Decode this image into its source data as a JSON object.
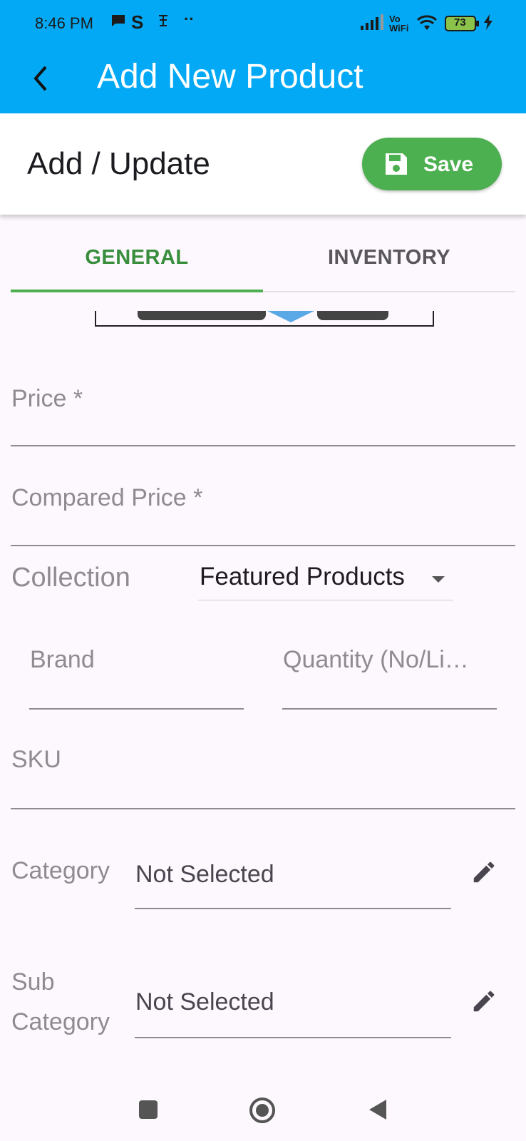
{
  "status_bar": {
    "time": "8:46 PM",
    "network": "Vo WiFi",
    "battery": "73"
  },
  "app_bar": {
    "title": "Add New Product",
    "back_icon": "chevron-left-icon"
  },
  "header": {
    "title": "Add / Update",
    "save_label": "Save",
    "save_icon": "floppy-disk-icon",
    "save_color": "#4caf50"
  },
  "tabs": [
    {
      "label": "GENERAL",
      "active": true
    },
    {
      "label": "INVENTORY",
      "active": false
    }
  ],
  "form": {
    "price_label": "Price *",
    "compared_price_label": "Compared Price *",
    "collection_label": "Collection",
    "collection_value": "Featured Products",
    "brand_label": "Brand",
    "quantity_label": "Quantity (No/Li…",
    "sku_label": "SKU",
    "category_label": "Category",
    "category_value": "Not Selected",
    "subcategory_label_line1": "Sub",
    "subcategory_label_line2": "Category",
    "subcategory_value": "Not Selected"
  },
  "colors": {
    "app_bar": "#03a9f4",
    "accent_green": "#4caf50"
  }
}
